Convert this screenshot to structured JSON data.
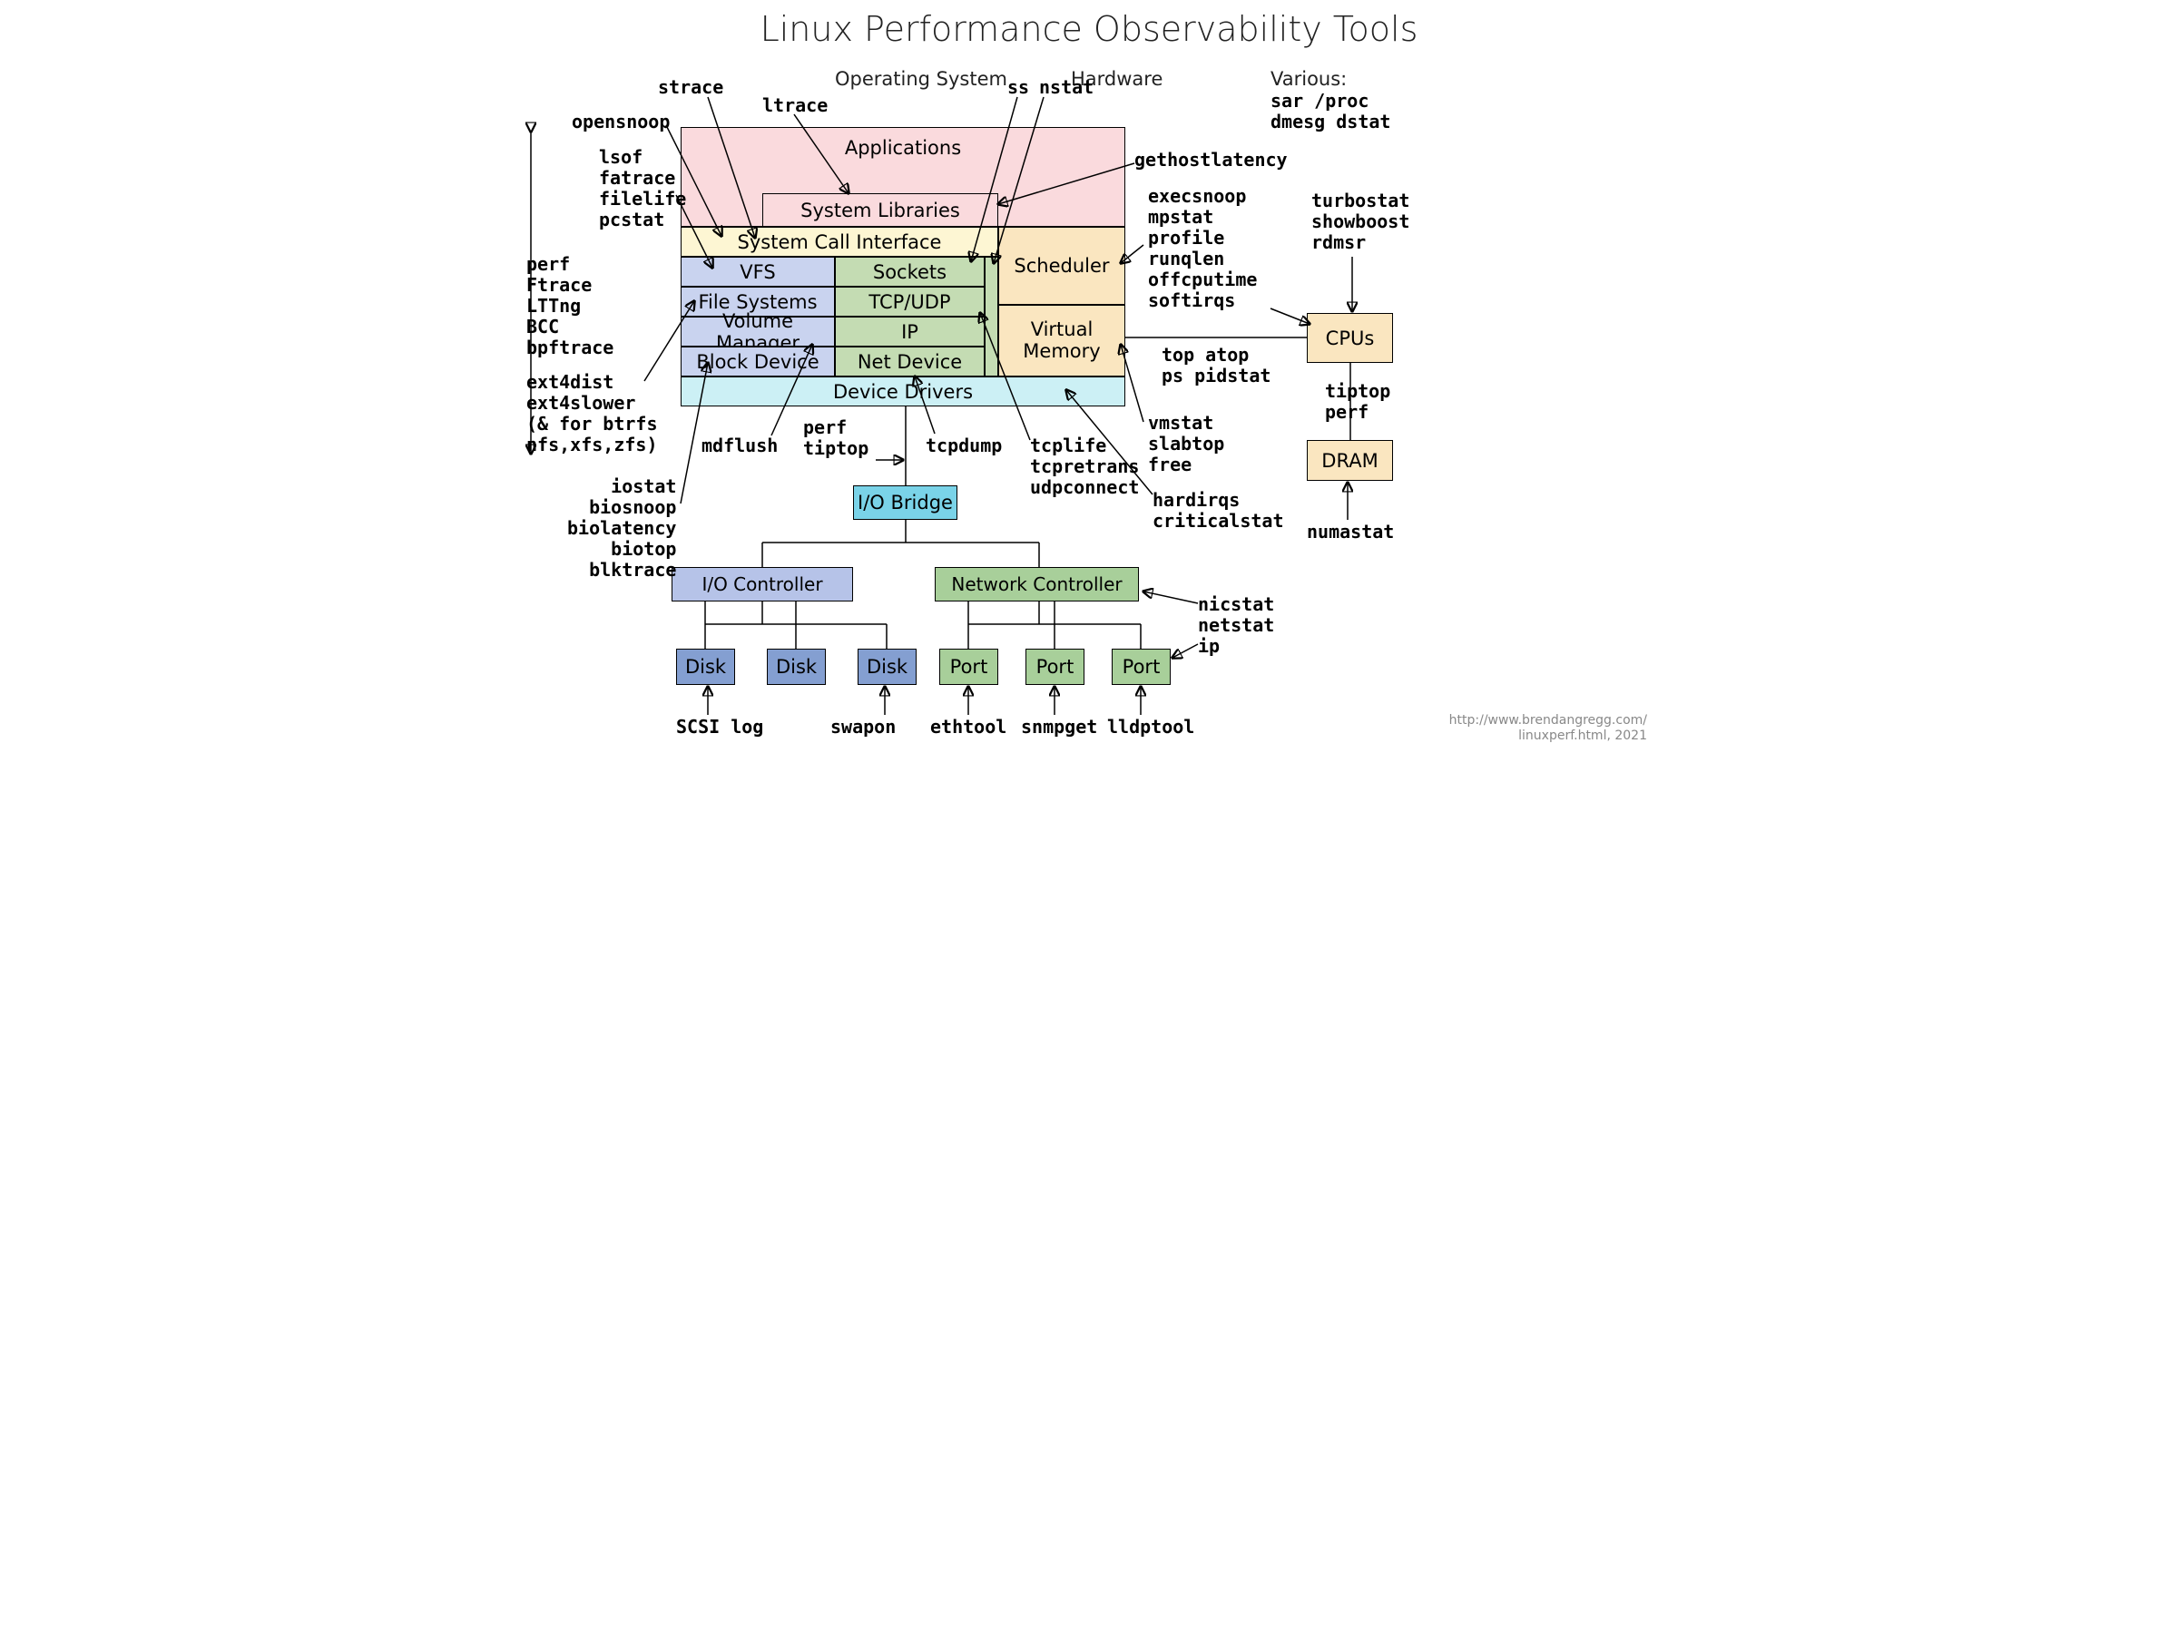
{
  "title": "Linux Performance Observability Tools",
  "sections": {
    "os": "Operating System",
    "hw": "Hardware",
    "various": "Various:"
  },
  "blocks": {
    "apps": "Applications",
    "syslibs": "System Libraries",
    "syscall": "System Call Interface",
    "vfs": "VFS",
    "fs": "File Systems",
    "volmgr": "Volume Manager",
    "blkdev": "Block Device",
    "sockets": "Sockets",
    "tcpudp": "TCP/UDP",
    "ip": "IP",
    "netdev": "Net Device",
    "sched": "Scheduler",
    "virtmem": "Virtual\nMemory",
    "drivers": "Device Drivers",
    "iobridge": "I/O Bridge",
    "ioctrl": "I/O Controller",
    "netctrl": "Network Controller",
    "disk": "Disk",
    "port": "Port",
    "cpus": "CPUs",
    "dram": "DRAM"
  },
  "tools": {
    "strace": "strace",
    "ltrace": "ltrace",
    "opensnoop": "opensnoop",
    "lsof_group": "lsof\nfatrace\nfilelife\npcstat",
    "perf_group": "perf\nFtrace\nLTTng\nBCC\nbpftrace",
    "ext4_group": "ext4dist\next4slower\n(& for btrfs\nnfs,xfs,zfs)",
    "iostat_group": "iostat\nbiosnoop\nbiolatency\nbiotop\nblktrace",
    "scsilog": "SCSI log",
    "mdflush": "mdflush",
    "perf_tiptop": "perf\ntiptop",
    "tcpdump": "tcpdump",
    "tcplife_group": "tcplife\ntcpretrans\nudpconnect",
    "ss": "ss",
    "nstat": "nstat",
    "gethostlatency": "gethostlatency",
    "execsnoop_group": "execsnoop\nmpstat\nprofile\nrunqlen\noffcputime\nsoftirqs",
    "top_group": "top atop\nps pidstat",
    "vmstat_group": "vmstat\nslabtop\nfree",
    "hardirqs_group": "hardirqs\ncriticalstat",
    "swapon": "swapon",
    "ethtool": "ethtool",
    "snmpget": "snmpget",
    "lldptool": "lldptool",
    "nicstat_group": "nicstat\nnetstat\nip",
    "various_tools": "sar /proc\ndmesg dstat",
    "turbostat_group": "turbostat\nshowboost\nrdmsr",
    "tiptop_perf": "tiptop\nperf",
    "numastat": "numastat"
  },
  "attrib": "http://www.brendangregg.com/\nlinuxperf.html, 2021"
}
